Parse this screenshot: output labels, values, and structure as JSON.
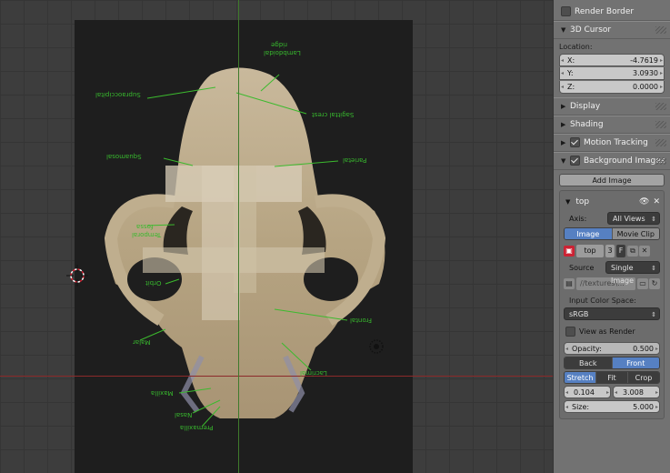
{
  "viewport": {
    "labels": {
      "lambdoidal": "Lambdoidal",
      "ridge": "ridge",
      "supraoccipital": "Supraoccipital",
      "sagittal": "Sagittal crest",
      "squamosal": "Squamosal",
      "parietal": "Parietal",
      "temporal": "Temporal",
      "fossa": "fossa",
      "orbit": "Orbit",
      "frontal": "Frontal",
      "malar": "Malar",
      "lacrimal": "Lacrimal",
      "maxilla": "Maxilla",
      "nasal": "Nasal",
      "premaxilla": "Premaxilla"
    }
  },
  "panel": {
    "render_border": "Render Border",
    "cursor_header": "3D Cursor",
    "location_label": "Location:",
    "loc_x_label": "X:",
    "loc_x": "-4.7619",
    "loc_y_label": "Y:",
    "loc_y": "3.0930",
    "loc_z_label": "Z:",
    "loc_z": "0.0000",
    "display": "Display",
    "shading": "Shading",
    "motion_tracking": "Motion Tracking",
    "background_images": "Background Images",
    "add_image": "Add Image",
    "bg": {
      "name": "top",
      "axis_label": "Axis:",
      "axis_value": "All Views",
      "tab_image": "Image",
      "tab_movie": "Movie Clip",
      "image_name": "top",
      "users": "3",
      "fake": "F",
      "source_label": "Source",
      "source_value": "Single Image",
      "filepath": "//textures\\...",
      "color_space_label": "Input Color Space:",
      "color_space_value": "sRGB",
      "view_as_render": "View as Render",
      "opacity_label": "Opacity:",
      "opacity_value": "0.500",
      "back": "Back",
      "front": "Front",
      "stretch": "Stretch",
      "fit": "Fit",
      "crop": "Crop",
      "offset_x": "0.104",
      "offset_y": "3.008",
      "size_label": "Size:",
      "size_value": "5.000"
    }
  }
}
